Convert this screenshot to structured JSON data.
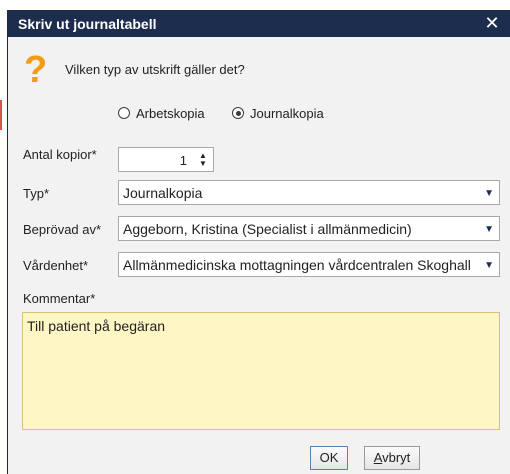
{
  "dialog": {
    "title": "Skriv ut journaltabell",
    "close_icon": "close-icon"
  },
  "prompt": {
    "icon": "question-icon",
    "icon_glyph": "?",
    "text": "Vilken typ av utskrift gäller det?"
  },
  "print_kind": {
    "options": [
      {
        "label": "Arbetskopia",
        "selected": false
      },
      {
        "label": "Journalkopia",
        "selected": true
      }
    ]
  },
  "fields": {
    "copies": {
      "label": "Antal kopior*",
      "value": "1"
    },
    "type": {
      "label": "Typ*",
      "value": "Journalkopia"
    },
    "reviewed_by": {
      "label": "Beprövad av*",
      "value": "Aggeborn, Kristina (Specialist i allmänmedicin)"
    },
    "care_unit": {
      "label": "Vårdenhet*",
      "value": "Allmänmedicinska mottagningen vårdcentralen Skoghall"
    },
    "comment": {
      "label": "Kommentar*",
      "value": "Till patient på begäran"
    }
  },
  "buttons": {
    "ok": "OK",
    "cancel_first": "A",
    "cancel_rest": "vbryt"
  },
  "colors": {
    "titlebar": "#1c2d4e",
    "question_icon": "#f39c12",
    "comment_bg": "#fff6c6"
  }
}
